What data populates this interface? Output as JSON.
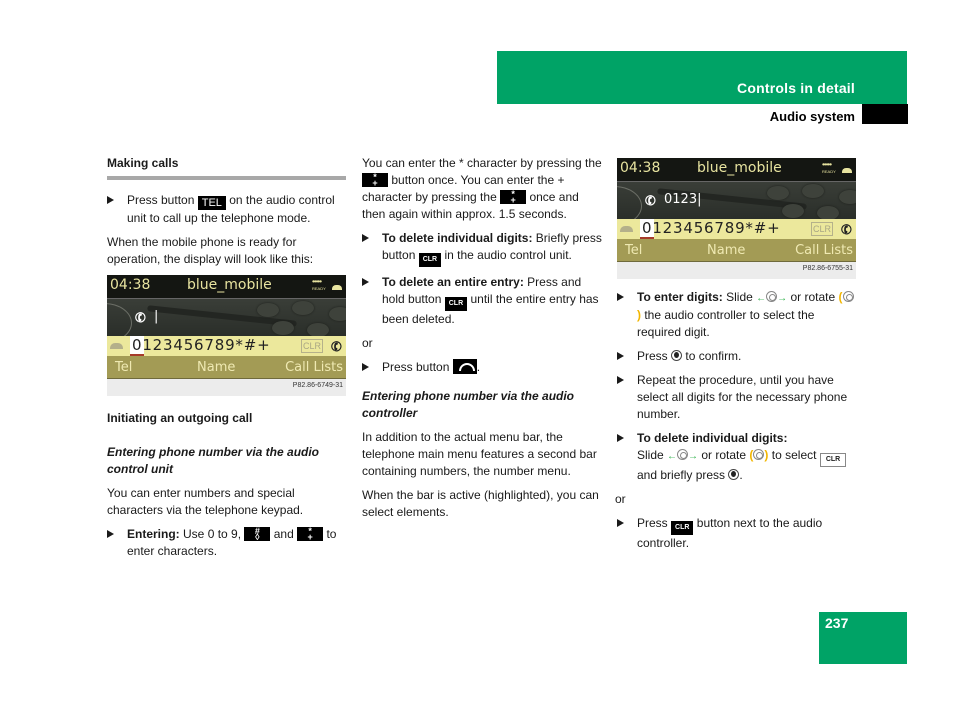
{
  "header": {
    "chapter": "Controls in detail",
    "section": "Audio system"
  },
  "page_number": "237",
  "colors": {
    "accent_green": "#00a366",
    "display_bg": "#141612",
    "display_text": "#e8e4a0",
    "number_bar": "#ece89c",
    "menu_bar": "#a39b55"
  },
  "col1": {
    "section_title": "Making calls",
    "bullet1_pre": "Press button",
    "bullet1_key": "TEL",
    "bullet1_post": "on the audio control unit to call up the telephone mode.",
    "para1": "When the mobile phone is ready for operation, the display will look like this:",
    "heading2": "Initiating an outgoing call",
    "subheading": "Entering phone number via the audio control unit",
    "para2": "You can enter numbers and special characters via the telephone keypad.",
    "bullet2_label": "Entering:",
    "bullet2_a": "Use 0 to 9,",
    "bullet2_b": "and",
    "bullet2_c": "to enter characters."
  },
  "col2": {
    "para1_a": "You can enter the * character by pressing the",
    "para1_b": "button once. You can enter the + character by pressing the",
    "para1_c": "once and then again within approx. 1.5 seconds.",
    "bullet1_label": "To delete individual digits:",
    "bullet1_a": "Briefly press button",
    "bullet1_b": "in the audio control unit.",
    "bullet2_label": "To delete an entire entry:",
    "bullet2_a": "Press and hold button",
    "bullet2_b": "until the entire entry has been deleted.",
    "or1": "or",
    "bullet3_a": "Press button",
    "bullet3_b": ".",
    "subheading": "Entering phone number via the audio controller",
    "para2": "In addition to the actual menu bar, the telephone main menu features a second bar containing numbers, the number menu.",
    "para3": "When the bar is active (highlighted), you can select elements."
  },
  "col3": {
    "bullet1_label": "To enter digits:",
    "bullet1_a": "Slide",
    "bullet1_b": "or rotate",
    "bullet1_c": "the audio controller to select the required digit.",
    "bullet2_a": "Press",
    "bullet2_b": "to confirm.",
    "bullet3": "Repeat the procedure, until you have select all digits for the necessary phone number.",
    "bullet4_label": "To delete individual digits:",
    "bullet4_a": "Slide",
    "bullet4_b": "or rotate",
    "bullet4_c": "to select",
    "bullet4_d": "and briefly press",
    "bullet4_e": ".",
    "or1": "or",
    "bullet5_a": "Press",
    "bullet5_b": "button next to the audio controller."
  },
  "keys": {
    "clr": "CLR",
    "star_top": "*",
    "star_bottom": "+",
    "hash_top": "#",
    "hash_bottom": "◊",
    "slide_symbol": "←◎→",
    "rotate_left": "(",
    "rotate_right": ")"
  },
  "displays": [
    {
      "time": "04:38",
      "device": "blue_mobile",
      "status": "READY",
      "signal": "•••••",
      "input": "|",
      "digits": "0123456789*#+",
      "clr": "CLR",
      "menu": [
        "Tel",
        "Name",
        "Call Lists"
      ],
      "code": "P82.86-6749-31"
    },
    {
      "time": "04:38",
      "device": "blue_mobile",
      "status": "READY",
      "signal": "•••••",
      "input": "0123|",
      "digits": "0123456789*#+",
      "clr": "CLR",
      "menu": [
        "Tel",
        "Name",
        "Call Lists"
      ],
      "code": "P82.86-6755-31"
    }
  ]
}
